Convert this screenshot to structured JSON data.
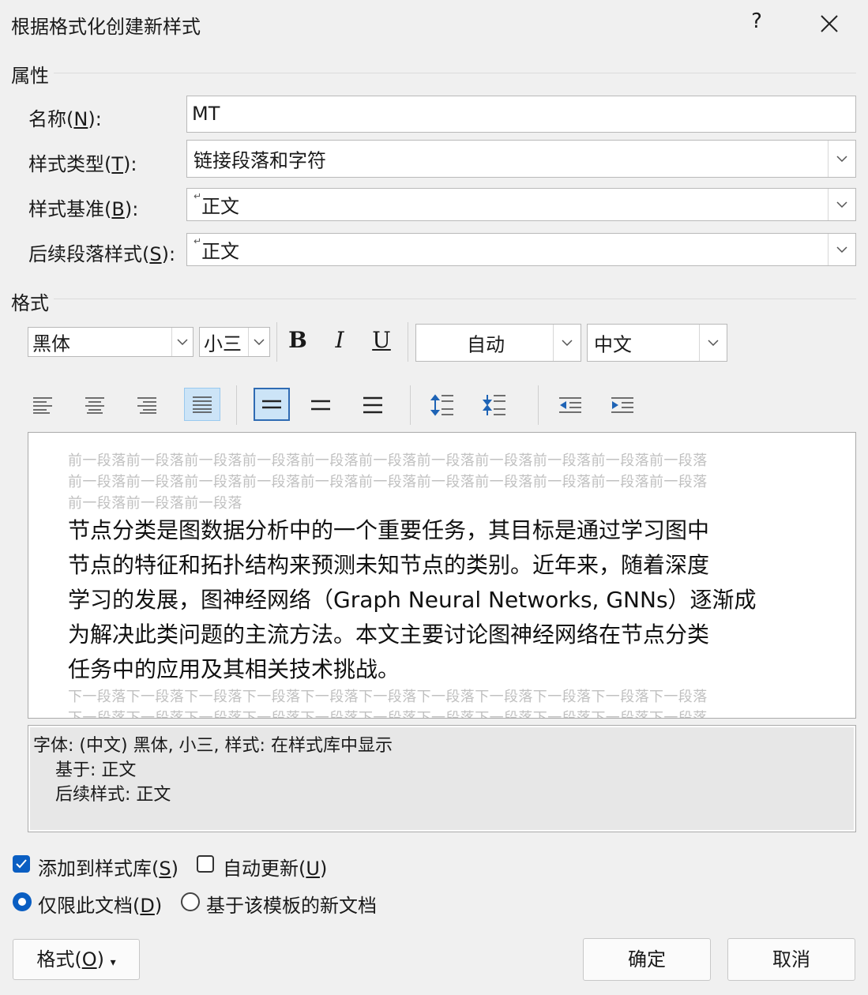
{
  "window": {
    "title": "根据格式化创建新样式",
    "help_glyph": "?",
    "close_glyph": "✕"
  },
  "properties": {
    "section_title": "属性",
    "name": {
      "label_pre": "名称(",
      "label_key": "N",
      "label_post": "):",
      "value": "MT"
    },
    "style_type": {
      "label_pre": "样式类型(",
      "label_key": "T",
      "label_post": "):",
      "value": "链接段落和字符"
    },
    "style_based_on": {
      "label_pre": "样式基准(",
      "label_key": "B",
      "label_post": "):",
      "value": "正文"
    },
    "next_style": {
      "label_pre": "后续段落样式(",
      "label_key": "S",
      "label_post": "):",
      "value": "正文"
    },
    "paragraph_mark": "↵"
  },
  "format": {
    "section_title": "格式",
    "font": "黑体",
    "size": "小三",
    "bold": "B",
    "italic": "I",
    "underline": "U",
    "color": "自动",
    "script": "中文"
  },
  "preview": {
    "prev_lines": [
      "前一段落前一段落前一段落前一段落前一段落前一段落前一段落前一段落前一段落前一段落前一段落",
      "前一段落前一段落前一段落前一段落前一段落前一段落前一段落前一段落前一段落前一段落前一段落",
      "前一段落前一段落前一段落"
    ],
    "sample_lines": [
      "节点分类是图数据分析中的一个重要任务，其目标是通过学习图中",
      "节点的特征和拓扑结构来预测未知节点的类别。近年来，随着深度",
      "学习的发展，图神经网络（Graph Neural Networks, GNNs）逐渐成",
      "为解决此类问题的主流方法。本文主要讨论图神经网络在节点分类",
      "任务中的应用及其相关技术挑战。"
    ],
    "next_lines": [
      "下一段落下一段落下一段落下一段落下一段落下一段落下一段落下一段落下一段落下一段落下一段落",
      "下一段落下一段落下一段落下一段落下一段落下一段落下一段落下一段落下一段落下一段落下一段落"
    ]
  },
  "description": {
    "line1": "字体: (中文) 黑体, 小三, 样式: 在样式库中显示",
    "line2": "基于: 正文",
    "line3": "后续样式: 正文"
  },
  "options": {
    "add_to_gallery": {
      "pre": "添加到样式库(",
      "key": "S",
      "post": ")",
      "checked": true
    },
    "auto_update": {
      "pre": "自动更新(",
      "key": "U",
      "post": ")",
      "checked": false
    },
    "this_document_only": {
      "pre": "仅限此文档(",
      "key": "D",
      "post": ")",
      "selected": true
    },
    "new_docs_template": {
      "label": "基于该模板的新文档",
      "selected": false
    }
  },
  "buttons": {
    "format": {
      "pre": "格式(",
      "key": "O",
      "post": ")",
      "caret": "▾"
    },
    "ok": "确定",
    "cancel": "取消"
  },
  "colors": {
    "accent": "#0a5ec2",
    "selected_bg": "#cce4f7",
    "selected_border": "#2f6bb3"
  }
}
